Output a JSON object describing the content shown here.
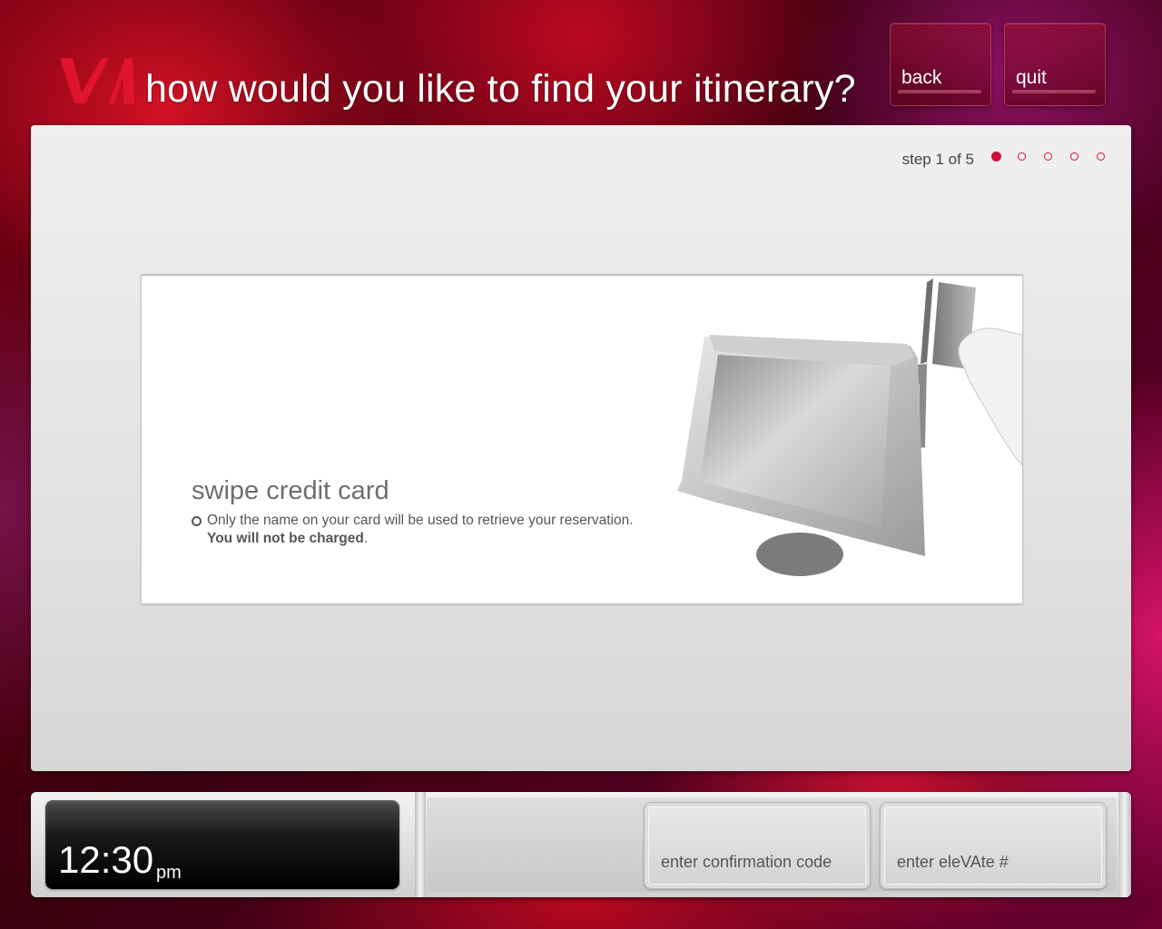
{
  "header": {
    "logo_text": "VA",
    "title": "how would you like to find your itinerary?",
    "back_label": "back",
    "quit_label": "quit"
  },
  "progress": {
    "step_text": "step 1 of 5",
    "current_step": 1,
    "total_steps": 5
  },
  "option": {
    "title": "swipe credit card",
    "description": "Only the name on your card will be used to retrieve your reservation.",
    "note": "You will not be charged",
    "note_end": "."
  },
  "clock": {
    "time": "12:30",
    "ampm": "pm"
  },
  "footer": {
    "confirmation_label": "enter confirmation code",
    "elevate_label": "enter eleVAte #"
  },
  "colors": {
    "brand_red": "#d0103a",
    "panel_gray": "#e6e6e6"
  }
}
